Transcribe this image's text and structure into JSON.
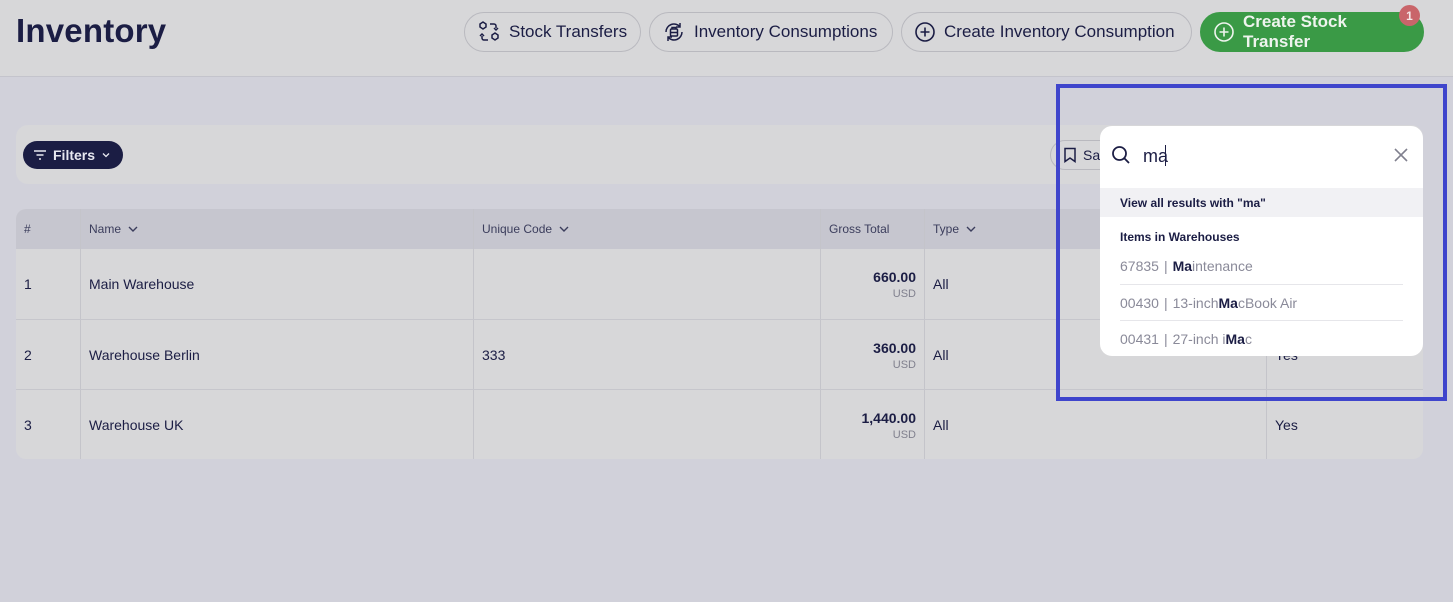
{
  "header": {
    "title": "Inventory",
    "buttons": {
      "stock_transfers": "Stock Transfers",
      "inventory_consumptions": "Inventory Consumptions",
      "create_inventory_consumption": "Create Inventory Consumption",
      "create_stock_transfer": "Create Stock Transfer"
    },
    "notification_count": "1",
    "accent_color": "#3a9a46"
  },
  "filterbar": {
    "filters_label": "Filters",
    "save_label": "Save"
  },
  "table": {
    "columns": [
      "#",
      "Name",
      "Unique Code",
      "Gross Total",
      "Type"
    ],
    "rows": [
      {
        "index": "1",
        "name": "Main Warehouse",
        "unique_code": "",
        "gross_total": "660.00",
        "currency": "USD",
        "type": "All",
        "last": ""
      },
      {
        "index": "2",
        "name": "Warehouse Berlin",
        "unique_code": "333",
        "gross_total": "360.00",
        "currency": "USD",
        "type": "All",
        "last": "Yes"
      },
      {
        "index": "3",
        "name": "Warehouse UK",
        "unique_code": "",
        "gross_total": "1,440.00",
        "currency": "USD",
        "type": "All",
        "last": "Yes"
      }
    ]
  },
  "search": {
    "query": "ma",
    "view_all_label": "View all results with \"ma\"",
    "group_title": "Items in Warehouses",
    "results": [
      {
        "code": "67835",
        "pre": "",
        "match": "Ma",
        "post": "intenance"
      },
      {
        "code": "00430",
        "pre": "13-inch ",
        "match": "Ma",
        "post": "cBook Air"
      },
      {
        "code": "00431",
        "pre": "27-inch i",
        "match": "Ma",
        "post": "c"
      }
    ]
  }
}
